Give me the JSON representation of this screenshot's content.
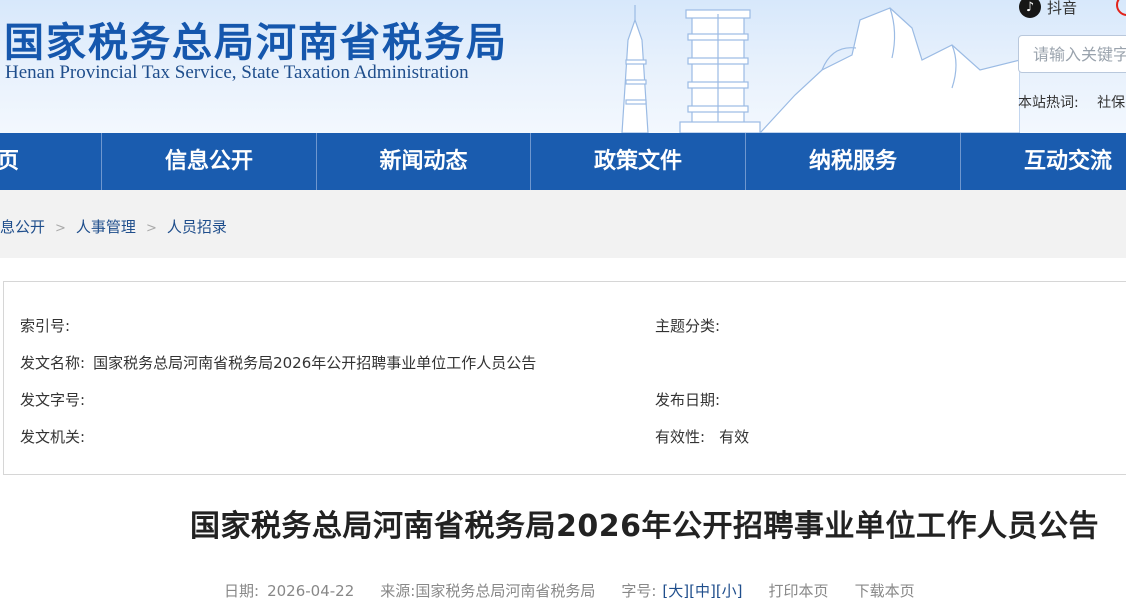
{
  "header": {
    "title": "国家税务总局河南省税务局",
    "subtitle": "Henan Provincial Tax Service, State Taxation Administration",
    "douyin_label": "抖音",
    "douyin_glyph": "♪",
    "search_placeholder": "请输入关键字",
    "hotwords_label": "本站热词:",
    "hotwords": [
      "社保"
    ]
  },
  "nav": {
    "items": [
      "首页",
      "信息公开",
      "新闻动态",
      "政策文件",
      "纳税服务",
      "互动交流"
    ]
  },
  "breadcrumb": {
    "items": [
      "信息公开",
      "人事管理",
      "人员招录"
    ],
    "separator": ">"
  },
  "meta": {
    "index_label": "索引号:",
    "index_value": "",
    "topic_label": "主题分类:",
    "topic_value": "",
    "doc_name_label": "发文名称:",
    "doc_name_value": "国家税务总局河南省税务局2026年公开招聘事业单位工作人员公告",
    "doc_number_label": "发文字号:",
    "doc_number_value": "",
    "publish_date_label": "发布日期:",
    "publish_date_value": "",
    "issuer_label": "发文机关:",
    "issuer_value": "",
    "validity_label": "有效性:",
    "validity_value": "有效"
  },
  "article": {
    "title": "国家税务总局河南省税务局2026年公开招聘事业单位工作人员公告",
    "date_label": "日期:",
    "date_value": "2026-04-22",
    "source_label": "来源:",
    "source_value": "国家税务总局河南省税务局",
    "font_size_label": "字号:",
    "font_large": "[大]",
    "font_medium": "[中]",
    "font_small": "[小]",
    "print_label": "打印本页",
    "download_label": "下载本页"
  },
  "colors": {
    "brand_blue": "#1557ad",
    "nav_blue": "#1a5caf",
    "link_blue": "#1f4e8c"
  }
}
